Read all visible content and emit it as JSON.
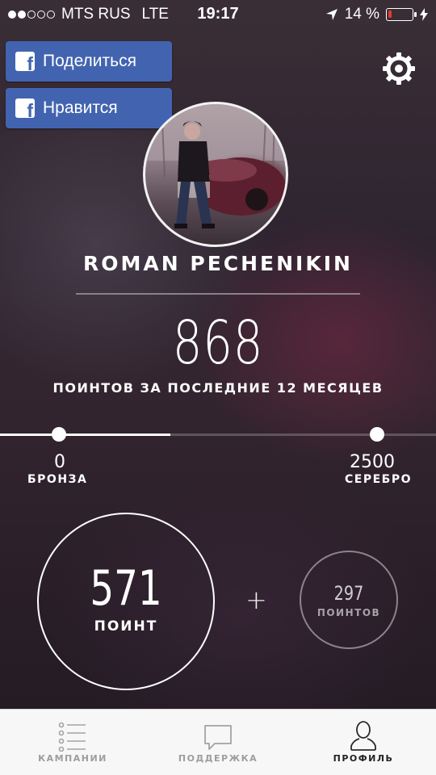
{
  "status_bar": {
    "carrier": "MTS RUS",
    "network": "LTE",
    "time": "19:17",
    "battery_percent": "14 %",
    "signal_bars": 2,
    "signal_total": 5,
    "battery_level": 0.14
  },
  "share_buttons": {
    "share_label": "Поделиться",
    "like_label": "Нравится",
    "fb_letter": "f"
  },
  "profile": {
    "name": "ROMAN PECHENIKIN",
    "points_total": "868",
    "points_caption": "ПОИНТОВ ЗА ПОСЛЕДНИЕ 12 МЕСЯЦЕВ"
  },
  "levels": {
    "progress_fraction": 0.39,
    "current": {
      "value": "0",
      "label": "БРОНЗА"
    },
    "next": {
      "value": "2500",
      "label": "СЕРЕБРО"
    }
  },
  "points_breakdown": {
    "main_value": "571",
    "main_label": "ПОИНТ",
    "plus": "+",
    "extra_value": "297",
    "extra_label": "ПОИНТОВ"
  },
  "tabs": [
    {
      "label": "КАМПАНИИ",
      "icon": "list-icon",
      "active": false
    },
    {
      "label": "ПОДДЕРЖКА",
      "icon": "chat-bubble-icon",
      "active": false
    },
    {
      "label": "ПРОФИЛЬ",
      "icon": "person-icon",
      "active": true
    }
  ],
  "colors": {
    "facebook": "#4264b0",
    "battery_low": "#e23b2e",
    "tab_active": "#222222",
    "tab_inactive": "#9d9d9d"
  }
}
